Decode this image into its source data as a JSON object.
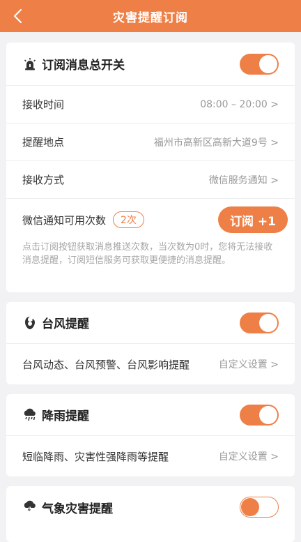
{
  "header": {
    "title": "灾害提醒订阅"
  },
  "master": {
    "title": "订阅消息总开关",
    "toggle_on": true,
    "rows": [
      {
        "label": "接收时间",
        "value": "08:00 – 20:00 >"
      },
      {
        "label": "提醒地点",
        "value": "福州市高新区高新大道9号 >"
      },
      {
        "label": "接收方式",
        "value": "微信服务通知 >"
      }
    ],
    "count_label": "微信通知可用次数",
    "count_badge": "2次",
    "subscribe_button": "订阅 +1",
    "hint": "点击订阅按钮获取消息推送次数，当次数为0时，您将无法接收消息提醒，订阅短信服务可获取更便捷的消息提醒。"
  },
  "typhoon": {
    "title": "台风提醒",
    "toggle_on": true,
    "desc": "台风动态、台风预警、台风影响提醒",
    "setting": "自定义设置 >"
  },
  "rain": {
    "title": "降雨提醒",
    "toggle_on": true,
    "desc": "短临降雨、灾害性强降雨等提醒",
    "setting": "自定义设置 >"
  },
  "weather": {
    "title": "气象灾害提醒",
    "toggle_on": false
  },
  "colors": {
    "accent": "#ee8047"
  }
}
